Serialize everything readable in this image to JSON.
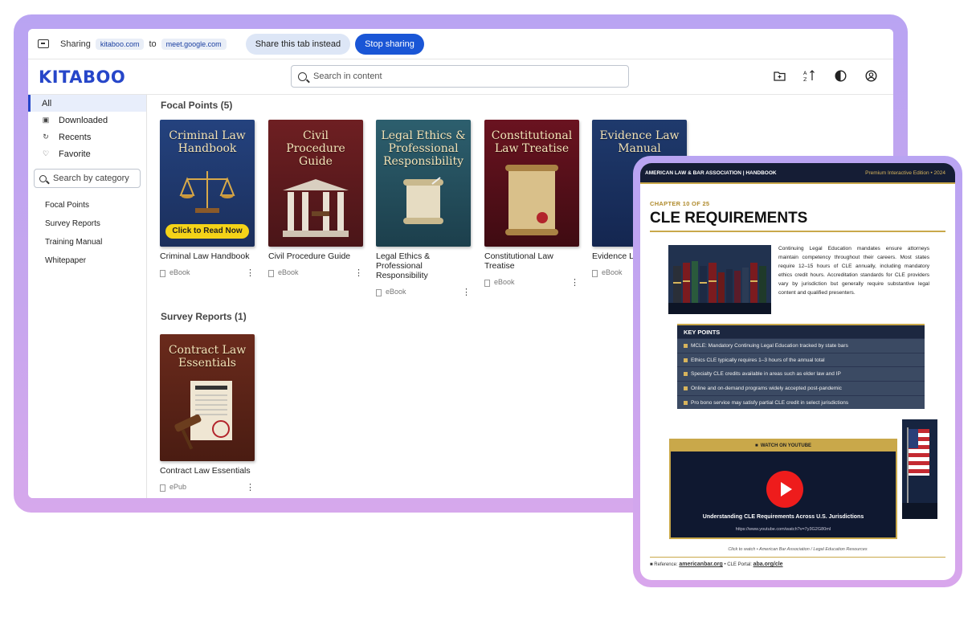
{
  "share_bar": {
    "prefix": "Sharing",
    "source": "kitaboo.com",
    "connector": "to",
    "target": "meet.google.com",
    "share_tab_label": "Share this tab instead",
    "stop_label": "Stop sharing"
  },
  "app": {
    "logo": "KITABOO",
    "search_placeholder": "Search in content"
  },
  "sidebar": {
    "items": [
      {
        "label": "All",
        "icon": "all-icon"
      },
      {
        "label": "Downloaded",
        "icon": "download-icon"
      },
      {
        "label": "Recents",
        "icon": "recent-icon"
      },
      {
        "label": "Favorite",
        "icon": "heart-icon"
      }
    ],
    "category_search_placeholder": "Search by category",
    "categories": [
      "Focal Points",
      "Survey Reports",
      "Training Manual",
      "Whitepaper"
    ]
  },
  "sections": [
    {
      "title": "Focal Points (5)",
      "books": [
        {
          "cover_title": "Criminal Law Handbook",
          "title": "Criminal Law Handbook",
          "type": "eBook",
          "cta": "Click to Read Now"
        },
        {
          "cover_title": "Civil Procedure Guide",
          "title": "Civil Procedure Guide",
          "type": "eBook"
        },
        {
          "cover_title": "Legal Ethics & Professional Responsibility",
          "title": "Legal Ethics & Professional Responsibility",
          "type": "eBook"
        },
        {
          "cover_title": "Constitutional Law Treatise",
          "title": "Constitutional Law Treatise",
          "type": "eBook"
        },
        {
          "cover_title": "Evidence Law Manual",
          "title": "Evidence Law Manual",
          "type": "eBook"
        }
      ]
    },
    {
      "title": "Survey Reports (1)",
      "books": [
        {
          "cover_title": "Contract Law Essentials",
          "title": "Contract Law Essentials",
          "type": "ePub"
        }
      ]
    }
  ],
  "tablet": {
    "header_left": "AMERICAN LAW & BAR ASSOCIATION  |  HANDBOOK",
    "header_right": "Premium Interactive Edition  •  2024",
    "chapter": "CHAPTER 10 OF 25",
    "title": "CLE REQUIREMENTS",
    "paragraph": "Continuing Legal Education mandates ensure attorneys maintain competency throughout their careers. Most states require 12–15 hours of CLE annually, including mandatory ethics credit hours. Accreditation standards for CLE providers vary by jurisdiction but generally require substantive legal content and qualified presenters.",
    "key_points_title": "KEY POINTS",
    "key_points": [
      "MCLE: Mandatory Continuing Legal Education tracked by state bars",
      "Ethics CLE typically requires 1–3 hours of the annual total",
      "Specialty CLE credits available in areas such as elder law and IP",
      "Online and on-demand programs widely accepted post-pandemic",
      "Pro bono service may satisfy partial CLE credit in select jurisdictions"
    ],
    "video_label": "WATCH ON YOUTUBE",
    "video_caption": "Understanding CLE Requirements Across U.S. Jurisdictions",
    "video_url": "https://www.youtube.com/watch?v=7y3G2G80mI",
    "watch_note": "Click to watch • American Bar Association / Legal Education Resources",
    "footer_ref_label": "Reference:",
    "footer_ref_link": "americanbar.org",
    "footer_portal_label": "• CLE Portal:",
    "footer_portal_link": "aba.org/cle"
  },
  "colors": {
    "brand": "#2646c9",
    "primary_button": "#1a56d6",
    "gold": "#c9a84a",
    "frame": "#c7a6ee",
    "play": "#ee1c1c"
  }
}
